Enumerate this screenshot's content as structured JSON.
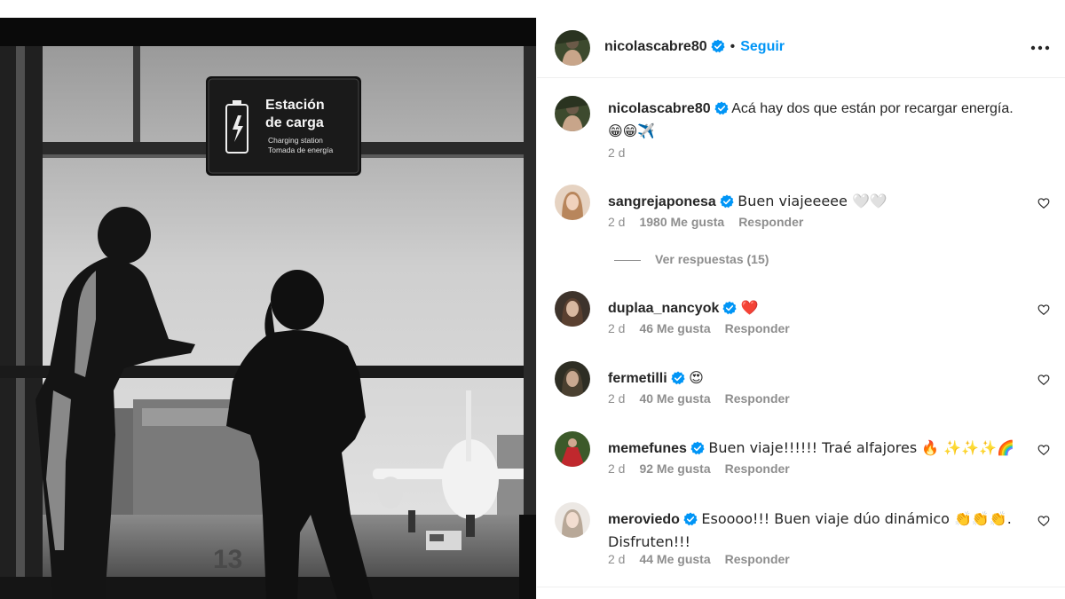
{
  "post": {
    "username": "nicolascabre80",
    "follow_dot": "•",
    "follow_label": "Seguir",
    "more_icon": "more-options-icon"
  },
  "photo": {
    "sign_title_1": "Estación",
    "sign_title_2": "de carga",
    "sign_sub_1": "Charging station",
    "sign_sub_2": "Tomada de energía",
    "gate_number": "13"
  },
  "caption": {
    "username": "nicolascabre80",
    "text": "Acá hay dos que están por recargar energía.",
    "emojis": "😁😁✈️",
    "time": "2 d"
  },
  "comments": [
    {
      "username": "sangrejaponesa",
      "text": "Buen viajeeeee 🤍🤍",
      "time": "2 d",
      "likes": "1980 Me gusta",
      "reply": "Responder",
      "avatar_color": "#c9a27e"
    },
    {
      "username": "duplaa_nancyok",
      "text": "❤️",
      "time": "2 d",
      "likes": "46 Me gusta",
      "reply": "Responder",
      "avatar_color": "#4a4038"
    },
    {
      "username": "fermetilli",
      "text": "😍",
      "time": "2 d",
      "likes": "40 Me gusta",
      "reply": "Responder",
      "avatar_color": "#3a3a2e"
    },
    {
      "username": "memefunes",
      "text": "Buen viaje!!!!!! Traé alfajores 🔥 ✨✨✨🌈",
      "time": "2 d",
      "likes": "92 Me gusta",
      "reply": "Responder",
      "avatar_color": "#c0282d"
    },
    {
      "username": "meroviedo",
      "text": "Esoooo!!! Buen viaje dúo dinámico 👏👏👏. Disfruten!!!",
      "time": "2 d",
      "likes": "44 Me gusta",
      "reply": "Responder",
      "avatar_color": "#d9d2cc"
    }
  ],
  "view_replies": "Ver respuestas (15)",
  "colors": {
    "accent": "#0095f6",
    "verified": "#0095f6",
    "muted": "#8e8e8e",
    "text": "#262626"
  }
}
